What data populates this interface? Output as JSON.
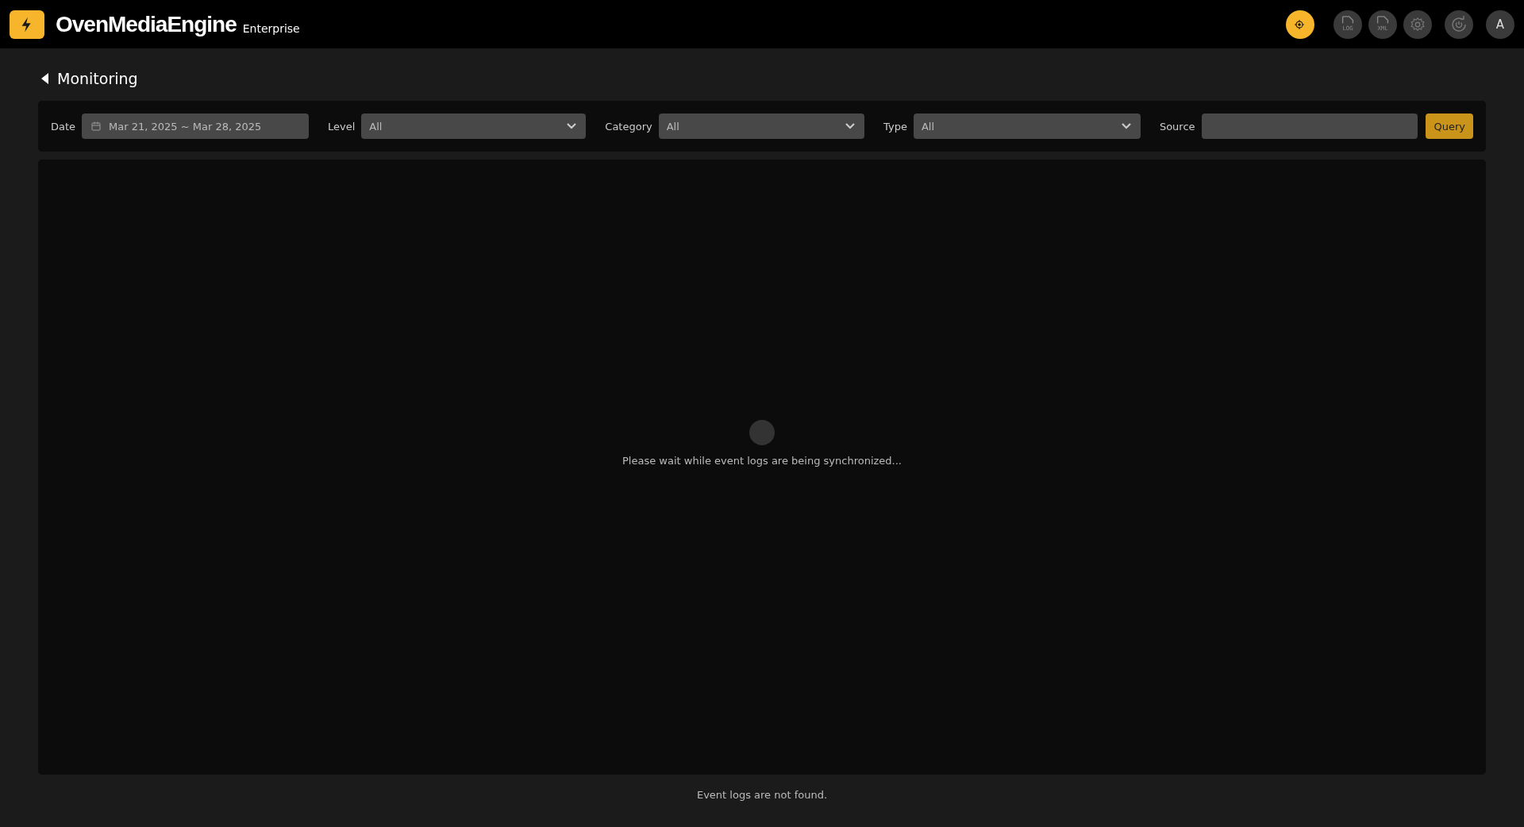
{
  "header": {
    "brand": "OvenMediaEngine",
    "edition": "Enterprise",
    "nav": [
      {
        "kind": "target",
        "selected": true
      },
      {
        "kind": "file",
        "label": "LOG",
        "selected": false
      },
      {
        "kind": "file",
        "label": "XML",
        "selected": false
      },
      {
        "kind": "gear",
        "selected": false
      },
      {
        "kind": "power",
        "selected": false
      }
    ],
    "avatar": "A"
  },
  "page": {
    "title": "Monitoring"
  },
  "filters": {
    "date_label": "Date",
    "date_value": "Mar 21, 2025 ~ Mar 28, 2025",
    "selects": [
      {
        "label": "Level",
        "value": "All"
      },
      {
        "label": "Category",
        "value": "All"
      },
      {
        "label": "Type",
        "value": "All"
      }
    ],
    "source_label": "Source",
    "query": "Query"
  },
  "status": "Please wait while event logs are being synchronized...",
  "footer": "Event logs are not found."
}
